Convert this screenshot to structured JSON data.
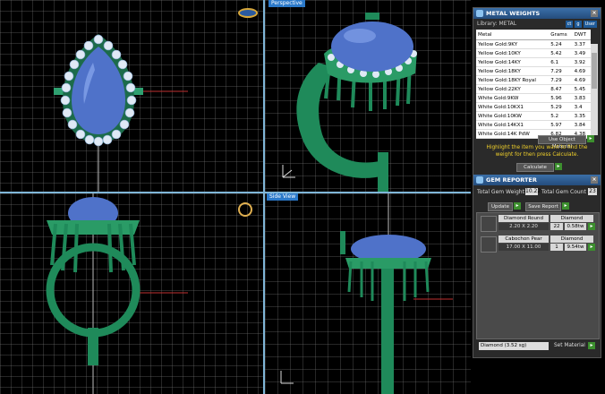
{
  "viewports": {
    "top_right_label": "Perspective",
    "bottom_right_label": "Side View"
  },
  "metal_weights": {
    "title": "METAL WEIGHTS",
    "library_label": "Library: METAL",
    "unit_buttons": [
      "ct",
      "g",
      "User"
    ],
    "columns": [
      "Metal",
      "Grams",
      "DWT"
    ],
    "rows": [
      [
        "Yellow Gold:9KY",
        "5.24",
        "3.37"
      ],
      [
        "Yellow Gold:10KY",
        "5.42",
        "3.49"
      ],
      [
        "Yellow Gold:14KY",
        "6.1",
        "3.92"
      ],
      [
        "Yellow Gold:18KY",
        "7.29",
        "4.69"
      ],
      [
        "Yellow Gold:18KY Royal",
        "7.29",
        "4.69"
      ],
      [
        "Yellow Gold:22KY",
        "8.47",
        "5.45"
      ],
      [
        "White Gold:9KW",
        "5.96",
        "3.83"
      ],
      [
        "White Gold:10KX1",
        "5.29",
        "3.4"
      ],
      [
        "White Gold:10KW",
        "5.2",
        "3.35"
      ],
      [
        "White Gold:14KX1",
        "5.97",
        "3.84"
      ],
      [
        "White Gold:14K PdW",
        "6.82",
        "4.38"
      ]
    ],
    "use_object_button": "Use Object Material",
    "hint": "Highlight the item you want to find the weight for then press Calculate.",
    "calculate_button": "Calculate"
  },
  "gem_reporter": {
    "title": "GEM REPORTER",
    "total_weight_label": "Total Gem Weight",
    "total_weight_value": "10.22",
    "total_count_label": "Total Gem Count",
    "total_count_value": "23",
    "update_button": "Update",
    "save_button": "Save Report",
    "gems": [
      {
        "name": "Diamond Round",
        "material": "Diamond",
        "size": "2.20 X 2.20",
        "count": "22",
        "weight": "0.58tw"
      },
      {
        "name": "Cabochon Pear",
        "material": "Diamond",
        "size": "17.00 X 11.00",
        "count": "1",
        "weight": "9.54tw"
      }
    ],
    "material_select": "Diamond   (3.52 sg)",
    "set_material_button": "Set Material"
  },
  "icons": [
    "ring-icon",
    "gem-icon",
    "close-icon",
    "go-arrow-icon",
    "axis-icon"
  ],
  "colors": {
    "ring_green": "#1f8a5a",
    "gem_blue": "#5b7fd6",
    "panel_header": "#2d5f96",
    "hint_yellow": "#f3d22a"
  }
}
